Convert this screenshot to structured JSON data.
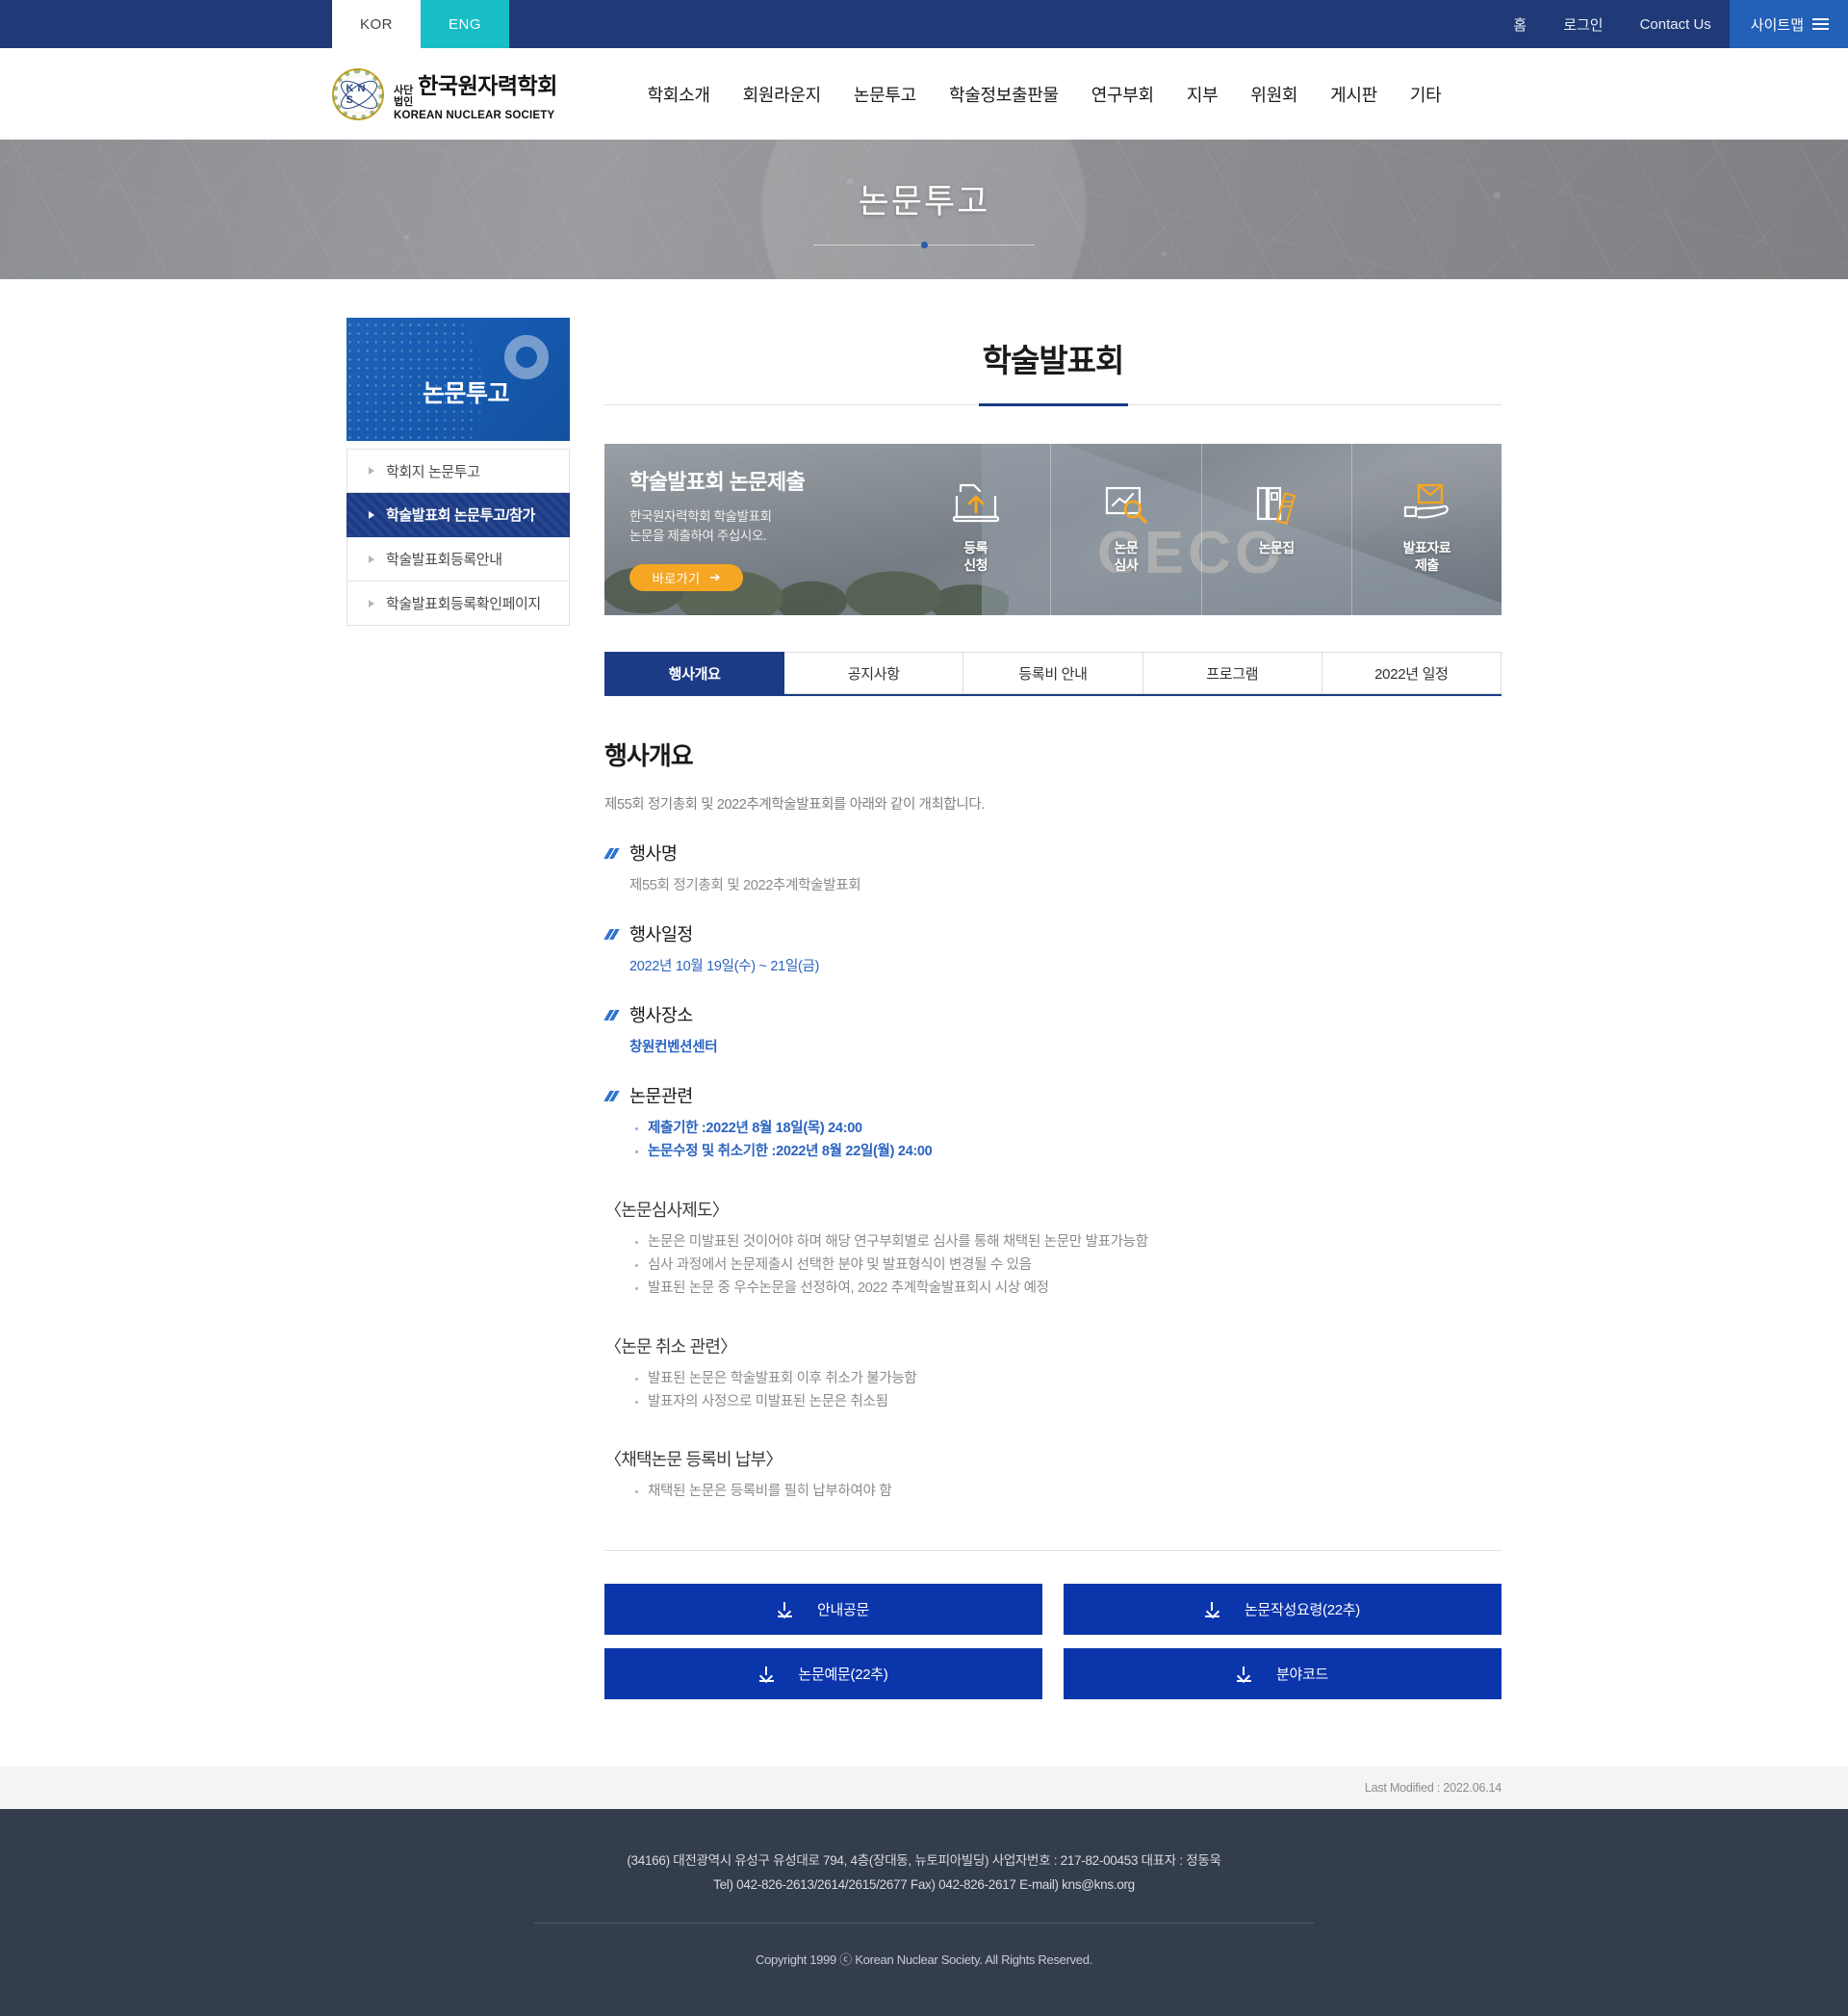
{
  "topbar": {
    "lang": [
      {
        "label": "KOR",
        "active": true
      },
      {
        "label": "ENG",
        "active": false
      }
    ],
    "links": [
      "홈",
      "로그인",
      "Contact Us"
    ],
    "sitemap_label": "사이트맵"
  },
  "header": {
    "logo": {
      "prefix_line1": "사단",
      "prefix_line2": "법인",
      "korean_name": "한국원자력학회",
      "english_name": "KOREAN NUCLEAR SOCIETY",
      "mark_text": "K N S"
    },
    "gnb": [
      "학회소개",
      "회원라운지",
      "논문투고",
      "학술정보출판물",
      "연구부회",
      "지부",
      "위원회",
      "게시판",
      "기타"
    ]
  },
  "hero": {
    "title": "논문투고"
  },
  "sidebar": {
    "heading": "논문투고",
    "items": [
      {
        "label": "학회지 논문투고",
        "active": false
      },
      {
        "label": "학술발표회 논문투고/참가",
        "active": true
      },
      {
        "label": "학술발표회등록안내",
        "active": false
      },
      {
        "label": "학술발표회등록확인페이지",
        "active": false
      }
    ]
  },
  "content": {
    "page_title": "학술발표회",
    "banner": {
      "title": "학술발표회 논문제출",
      "desc_line1": "한국원자력학회 학술발표회",
      "desc_line2": "논문을 제출하여 주십시오.",
      "cta": "바로가기",
      "cells": [
        {
          "icon": "upload-document-icon",
          "line1": "등록",
          "line2": "신청"
        },
        {
          "icon": "review-magnifier-icon",
          "line1": "논문",
          "line2": "심사"
        },
        {
          "icon": "books-icon",
          "line1": "논문집",
          "line2": ""
        },
        {
          "icon": "hand-envelope-icon",
          "line1": "발표자료",
          "line2": "제출"
        }
      ]
    },
    "tabs": [
      {
        "label": "행사개요",
        "active": true
      },
      {
        "label": "공지사항",
        "active": false
      },
      {
        "label": "등록비 안내",
        "active": false
      },
      {
        "label": "프로그램",
        "active": false
      },
      {
        "label": "2022년 일정",
        "active": false
      }
    ],
    "section_heading": "행사개요",
    "lead": "제55회 정기총회 및 2022추계학술발표회를 아래와 같이 개최합니다.",
    "fields": [
      {
        "title": "행사명",
        "value": "제55회 정기총회 및 2022추계학술발표회",
        "style": "grey"
      },
      {
        "title": "행사일정",
        "value": "2022년 10월 19일(수) ~ 21일(금)",
        "style": "blue"
      },
      {
        "title": "행사장소",
        "value": "창원컨벤션센터",
        "style": "blue-bold"
      }
    ],
    "paper_field": {
      "title": "논문관련",
      "items": [
        "제출기한 :2022년 8월 18일(목) 24:00",
        "논문수정 및 취소기한 :2022년 8월 22일(월) 24:00"
      ]
    },
    "groups": [
      {
        "heading": "〈논문심사제도〉",
        "items": [
          "논문은 미발표된 것이어야 하며 해당 연구부회별로 심사를 통해 채택된 논문만 발표가능함",
          "심사 과정에서 논문제출시 선택한 분야 및 발표형식이 변경될 수 있음",
          "발표된 논문 중 우수논문을 선정하여, 2022 추계학술발표회시 시상 예정"
        ]
      },
      {
        "heading": "〈논문 취소 관련〉",
        "items": [
          "발표된 논문은 학술발표회 이후 취소가 불가능함",
          "발표자의 사정으로 미발표된 논문은 취소됨"
        ]
      },
      {
        "heading": "〈채택논문 등록비 납부〉",
        "items": [
          "채택된 논문은 등록비를 필히 납부하여야 함"
        ]
      }
    ],
    "downloads": [
      "안내공문",
      "논문작성요령(22추)",
      "논문예문(22추)",
      "분야코드"
    ]
  },
  "lastmod": "Last Modified : 2022.06.14",
  "footer": {
    "address": "(34166) 대전광역시 유성구 유성대로 794, 4층(장대동, 뉴토피아빌딩) 사업자번호 : 217-82-00453 대표자 : 정동욱",
    "contact": "Tel) 042-826-2613/2614/2615/2677 Fax) 042-826-2617 E-mail) kns@kns.org",
    "copyright": "Copyright 1999 ⓒ Korean Nuclear Society. All Rights Reserved."
  },
  "colors": {
    "navy": "#1f3a76",
    "deep_navy": "#1b3b86",
    "teal": "#17bec6",
    "sitemap_blue": "#2360b7",
    "accent_blue": "#2a63c1",
    "download_blue": "#0b35ab",
    "orange": "#f5a623",
    "footer": "#343d4b"
  }
}
